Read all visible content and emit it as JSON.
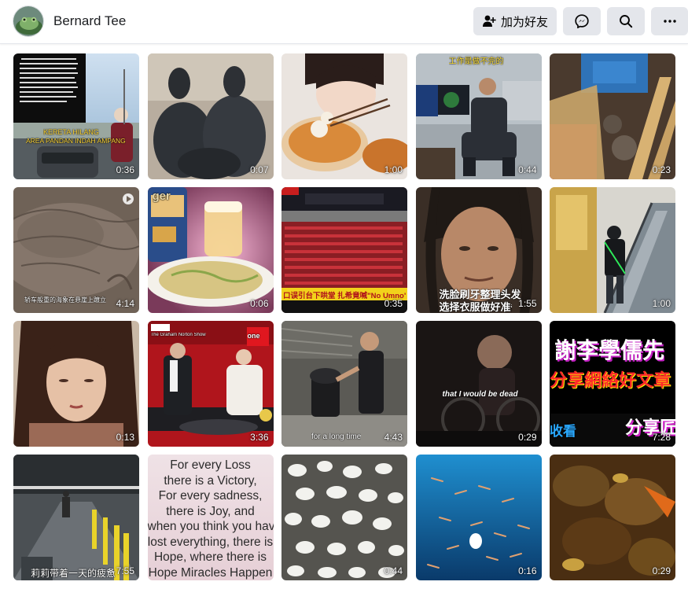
{
  "header": {
    "profile_name": "Bernard Tee",
    "add_friend_label": "加为好友",
    "avatar_icon": "frog-avatar-photo",
    "messenger_icon": "messenger-icon",
    "search_icon": "search-icon",
    "more_icon": "more-icon"
  },
  "videos": [
    {
      "duration": "0:36",
      "caption_1": "KERETA HILANG",
      "caption_2": "AREA PANDAN INDAH AMPANG"
    },
    {
      "duration": "0:07"
    },
    {
      "duration": "1:00"
    },
    {
      "duration": "0:44",
      "caption": "工作是做不完的"
    },
    {
      "duration": "0:23"
    },
    {
      "duration": "4:14",
      "caption": "轿车般重的海象在悬崖上踱立"
    },
    {
      "duration": "0:06"
    },
    {
      "duration": "0:35",
      "caption": "口误引台下哄堂   扎希竟喊\"No Umno\""
    },
    {
      "duration": "1:55",
      "caption_1": "洗脸刷牙整理头发",
      "caption_2": "选择衣服做好准备"
    },
    {
      "duration": "1:00"
    },
    {
      "duration": "0:13"
    },
    {
      "duration": "3:36",
      "caption": "The Graham Norton Show"
    },
    {
      "duration": "4:43",
      "caption": "for a long time"
    },
    {
      "duration": "0:29",
      "caption": "that I would be dead"
    },
    {
      "duration": "7:28",
      "caption_1": "謝李學儒先",
      "caption_2": "分享網絡好文章",
      "caption_3": "收看",
      "caption_4": "分享匠"
    },
    {
      "duration": "7:55",
      "caption": "莉莉带着一天的疲惫"
    },
    {
      "duration": "",
      "quote": [
        "For every Loss",
        "there is a Victory,",
        "For every sadness,",
        "there is Joy, and",
        "when you think you have",
        "lost everything, there is",
        "Hope, where there is",
        "Hope Miracles Happen"
      ]
    },
    {
      "duration": "0:44"
    },
    {
      "duration": "0:16"
    },
    {
      "duration": "0:29"
    }
  ]
}
